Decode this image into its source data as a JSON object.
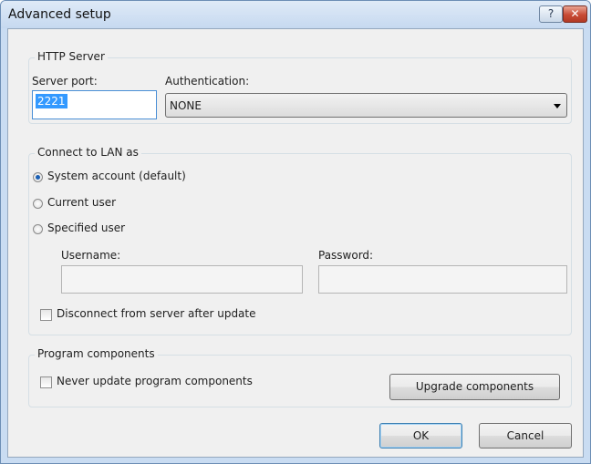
{
  "window": {
    "title": "Advanced setup",
    "help_glyph": "?",
    "close_glyph": "✕"
  },
  "http_server": {
    "group_label": "HTTP Server",
    "port_label": "Server port:",
    "port_value": "2221",
    "auth_label": "Authentication:",
    "auth_value": "NONE"
  },
  "connect": {
    "group_label": "Connect to LAN as",
    "options": [
      "System account (default)",
      "Current user",
      "Specified user"
    ],
    "selected": "System account (default)",
    "username_label": "Username:",
    "username_value": "",
    "password_label": "Password:",
    "password_value": "",
    "disconnect_label": "Disconnect from server after update",
    "disconnect_checked": false
  },
  "components": {
    "group_label": "Program components",
    "never_update_label": "Never update program components",
    "never_update_checked": false,
    "upgrade_label": "Upgrade components"
  },
  "buttons": {
    "ok": "OK",
    "cancel": "Cancel"
  },
  "colors": {
    "accent": "#3399ff",
    "title_gradient_top": "#dfeaf7",
    "close_red": "#c84a35"
  }
}
